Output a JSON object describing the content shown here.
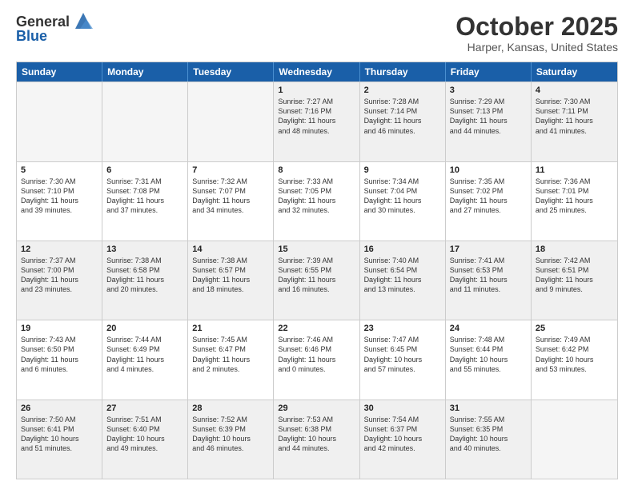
{
  "header": {
    "logo_line1": "General",
    "logo_line2": "Blue",
    "month": "October 2025",
    "location": "Harper, Kansas, United States"
  },
  "weekdays": [
    "Sunday",
    "Monday",
    "Tuesday",
    "Wednesday",
    "Thursday",
    "Friday",
    "Saturday"
  ],
  "weeks": [
    [
      {
        "day": "",
        "info": "",
        "empty": true
      },
      {
        "day": "",
        "info": "",
        "empty": true
      },
      {
        "day": "",
        "info": "",
        "empty": true
      },
      {
        "day": "1",
        "info": "Sunrise: 7:27 AM\nSunset: 7:16 PM\nDaylight: 11 hours\nand 48 minutes.",
        "empty": false
      },
      {
        "day": "2",
        "info": "Sunrise: 7:28 AM\nSunset: 7:14 PM\nDaylight: 11 hours\nand 46 minutes.",
        "empty": false
      },
      {
        "day": "3",
        "info": "Sunrise: 7:29 AM\nSunset: 7:13 PM\nDaylight: 11 hours\nand 44 minutes.",
        "empty": false
      },
      {
        "day": "4",
        "info": "Sunrise: 7:30 AM\nSunset: 7:11 PM\nDaylight: 11 hours\nand 41 minutes.",
        "empty": false
      }
    ],
    [
      {
        "day": "5",
        "info": "Sunrise: 7:30 AM\nSunset: 7:10 PM\nDaylight: 11 hours\nand 39 minutes.",
        "empty": false
      },
      {
        "day": "6",
        "info": "Sunrise: 7:31 AM\nSunset: 7:08 PM\nDaylight: 11 hours\nand 37 minutes.",
        "empty": false
      },
      {
        "day": "7",
        "info": "Sunrise: 7:32 AM\nSunset: 7:07 PM\nDaylight: 11 hours\nand 34 minutes.",
        "empty": false
      },
      {
        "day": "8",
        "info": "Sunrise: 7:33 AM\nSunset: 7:05 PM\nDaylight: 11 hours\nand 32 minutes.",
        "empty": false
      },
      {
        "day": "9",
        "info": "Sunrise: 7:34 AM\nSunset: 7:04 PM\nDaylight: 11 hours\nand 30 minutes.",
        "empty": false
      },
      {
        "day": "10",
        "info": "Sunrise: 7:35 AM\nSunset: 7:02 PM\nDaylight: 11 hours\nand 27 minutes.",
        "empty": false
      },
      {
        "day": "11",
        "info": "Sunrise: 7:36 AM\nSunset: 7:01 PM\nDaylight: 11 hours\nand 25 minutes.",
        "empty": false
      }
    ],
    [
      {
        "day": "12",
        "info": "Sunrise: 7:37 AM\nSunset: 7:00 PM\nDaylight: 11 hours\nand 23 minutes.",
        "empty": false
      },
      {
        "day": "13",
        "info": "Sunrise: 7:38 AM\nSunset: 6:58 PM\nDaylight: 11 hours\nand 20 minutes.",
        "empty": false
      },
      {
        "day": "14",
        "info": "Sunrise: 7:38 AM\nSunset: 6:57 PM\nDaylight: 11 hours\nand 18 minutes.",
        "empty": false
      },
      {
        "day": "15",
        "info": "Sunrise: 7:39 AM\nSunset: 6:55 PM\nDaylight: 11 hours\nand 16 minutes.",
        "empty": false
      },
      {
        "day": "16",
        "info": "Sunrise: 7:40 AM\nSunset: 6:54 PM\nDaylight: 11 hours\nand 13 minutes.",
        "empty": false
      },
      {
        "day": "17",
        "info": "Sunrise: 7:41 AM\nSunset: 6:53 PM\nDaylight: 11 hours\nand 11 minutes.",
        "empty": false
      },
      {
        "day": "18",
        "info": "Sunrise: 7:42 AM\nSunset: 6:51 PM\nDaylight: 11 hours\nand 9 minutes.",
        "empty": false
      }
    ],
    [
      {
        "day": "19",
        "info": "Sunrise: 7:43 AM\nSunset: 6:50 PM\nDaylight: 11 hours\nand 6 minutes.",
        "empty": false
      },
      {
        "day": "20",
        "info": "Sunrise: 7:44 AM\nSunset: 6:49 PM\nDaylight: 11 hours\nand 4 minutes.",
        "empty": false
      },
      {
        "day": "21",
        "info": "Sunrise: 7:45 AM\nSunset: 6:47 PM\nDaylight: 11 hours\nand 2 minutes.",
        "empty": false
      },
      {
        "day": "22",
        "info": "Sunrise: 7:46 AM\nSunset: 6:46 PM\nDaylight: 11 hours\nand 0 minutes.",
        "empty": false
      },
      {
        "day": "23",
        "info": "Sunrise: 7:47 AM\nSunset: 6:45 PM\nDaylight: 10 hours\nand 57 minutes.",
        "empty": false
      },
      {
        "day": "24",
        "info": "Sunrise: 7:48 AM\nSunset: 6:44 PM\nDaylight: 10 hours\nand 55 minutes.",
        "empty": false
      },
      {
        "day": "25",
        "info": "Sunrise: 7:49 AM\nSunset: 6:42 PM\nDaylight: 10 hours\nand 53 minutes.",
        "empty": false
      }
    ],
    [
      {
        "day": "26",
        "info": "Sunrise: 7:50 AM\nSunset: 6:41 PM\nDaylight: 10 hours\nand 51 minutes.",
        "empty": false
      },
      {
        "day": "27",
        "info": "Sunrise: 7:51 AM\nSunset: 6:40 PM\nDaylight: 10 hours\nand 49 minutes.",
        "empty": false
      },
      {
        "day": "28",
        "info": "Sunrise: 7:52 AM\nSunset: 6:39 PM\nDaylight: 10 hours\nand 46 minutes.",
        "empty": false
      },
      {
        "day": "29",
        "info": "Sunrise: 7:53 AM\nSunset: 6:38 PM\nDaylight: 10 hours\nand 44 minutes.",
        "empty": false
      },
      {
        "day": "30",
        "info": "Sunrise: 7:54 AM\nSunset: 6:37 PM\nDaylight: 10 hours\nand 42 minutes.",
        "empty": false
      },
      {
        "day": "31",
        "info": "Sunrise: 7:55 AM\nSunset: 6:35 PM\nDaylight: 10 hours\nand 40 minutes.",
        "empty": false
      },
      {
        "day": "",
        "info": "",
        "empty": true
      }
    ]
  ]
}
